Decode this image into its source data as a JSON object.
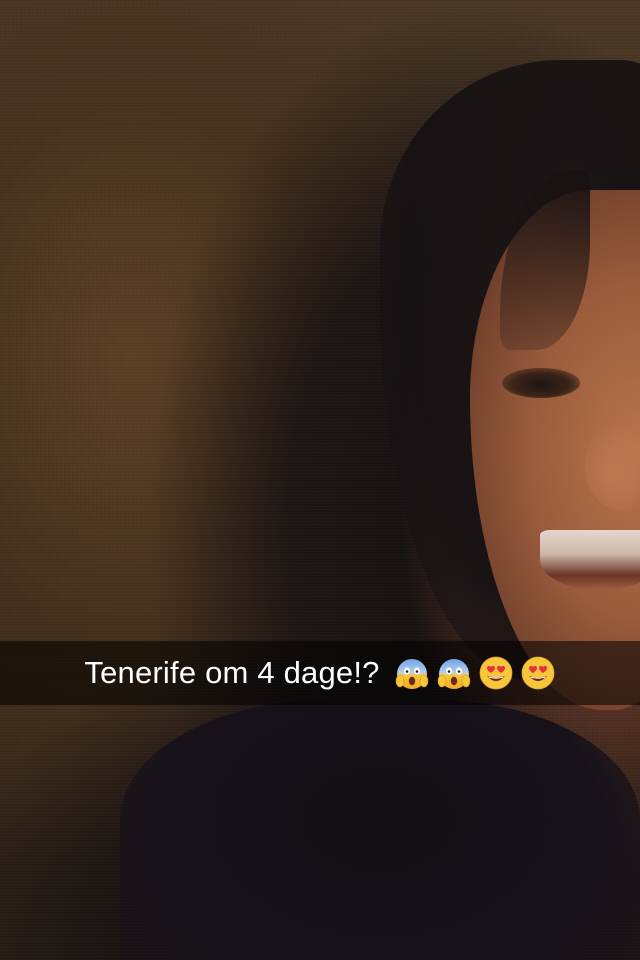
{
  "snap": {
    "caption": {
      "text": "Tenerife om 4 dage!?",
      "emojis": [
        "face-screaming-in-fear-icon",
        "face-screaming-in-fear-icon",
        "smiling-face-with-heart-eyes-icon",
        "smiling-face-with-heart-eyes-icon"
      ]
    }
  },
  "colors": {
    "caption_bar": "#000000",
    "caption_text": "#ffffff",
    "emoji_yellow": "#f7c63a"
  }
}
